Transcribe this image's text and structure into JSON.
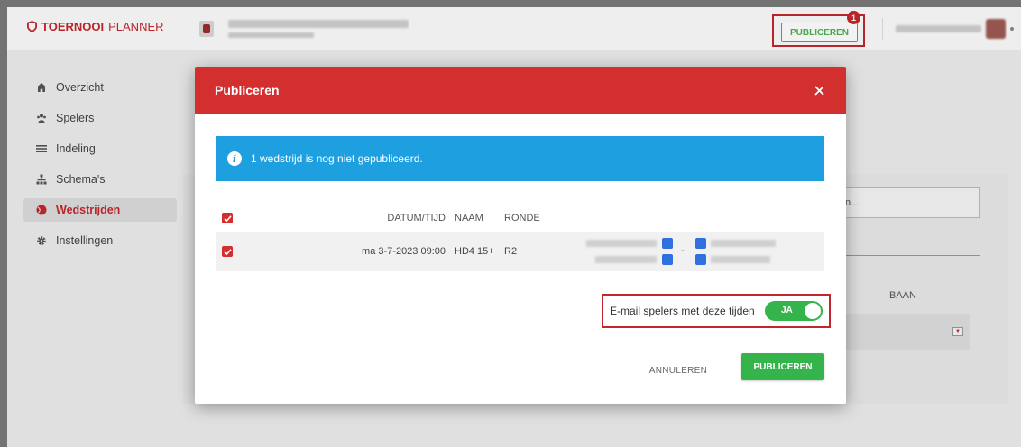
{
  "header": {
    "logo_bold": "TOERNOOI",
    "logo_light": "PLANNER",
    "publish_label": "PUBLICEREN",
    "publish_count": "1"
  },
  "sidebar": {
    "items": [
      {
        "label": "Overzicht",
        "icon": "home-icon"
      },
      {
        "label": "Spelers",
        "icon": "players-icon"
      },
      {
        "label": "Indeling",
        "icon": "list-icon"
      },
      {
        "label": "Schema's",
        "icon": "bracket-icon"
      },
      {
        "label": "Wedstrijden",
        "icon": "ball-icon",
        "active": true
      },
      {
        "label": "Instellingen",
        "icon": "gear-icon"
      }
    ]
  },
  "background": {
    "search_placeholder": "n...",
    "baan_label": "BAAN"
  },
  "modal": {
    "title": "Publiceren",
    "info": "1 wedstrijd is nog niet gepubliceerd.",
    "table": {
      "headers": {
        "datetime": "DATUM/TIJD",
        "naam": "NAAM",
        "ronde": "RONDE"
      },
      "rows": [
        {
          "datetime": "ma 3-7-2023 09:00",
          "naam": "HD4 15+",
          "ronde": "R2",
          "vs": "-"
        }
      ]
    },
    "email_label": "E-mail spelers met deze tijden",
    "toggle_label": "JA",
    "cancel_label": "ANNULEREN",
    "publish_label": "PUBLICEREN"
  },
  "colors": {
    "brand_red": "#d32f2f",
    "info_blue": "#1e9fe0",
    "success_green": "#34b44a"
  }
}
